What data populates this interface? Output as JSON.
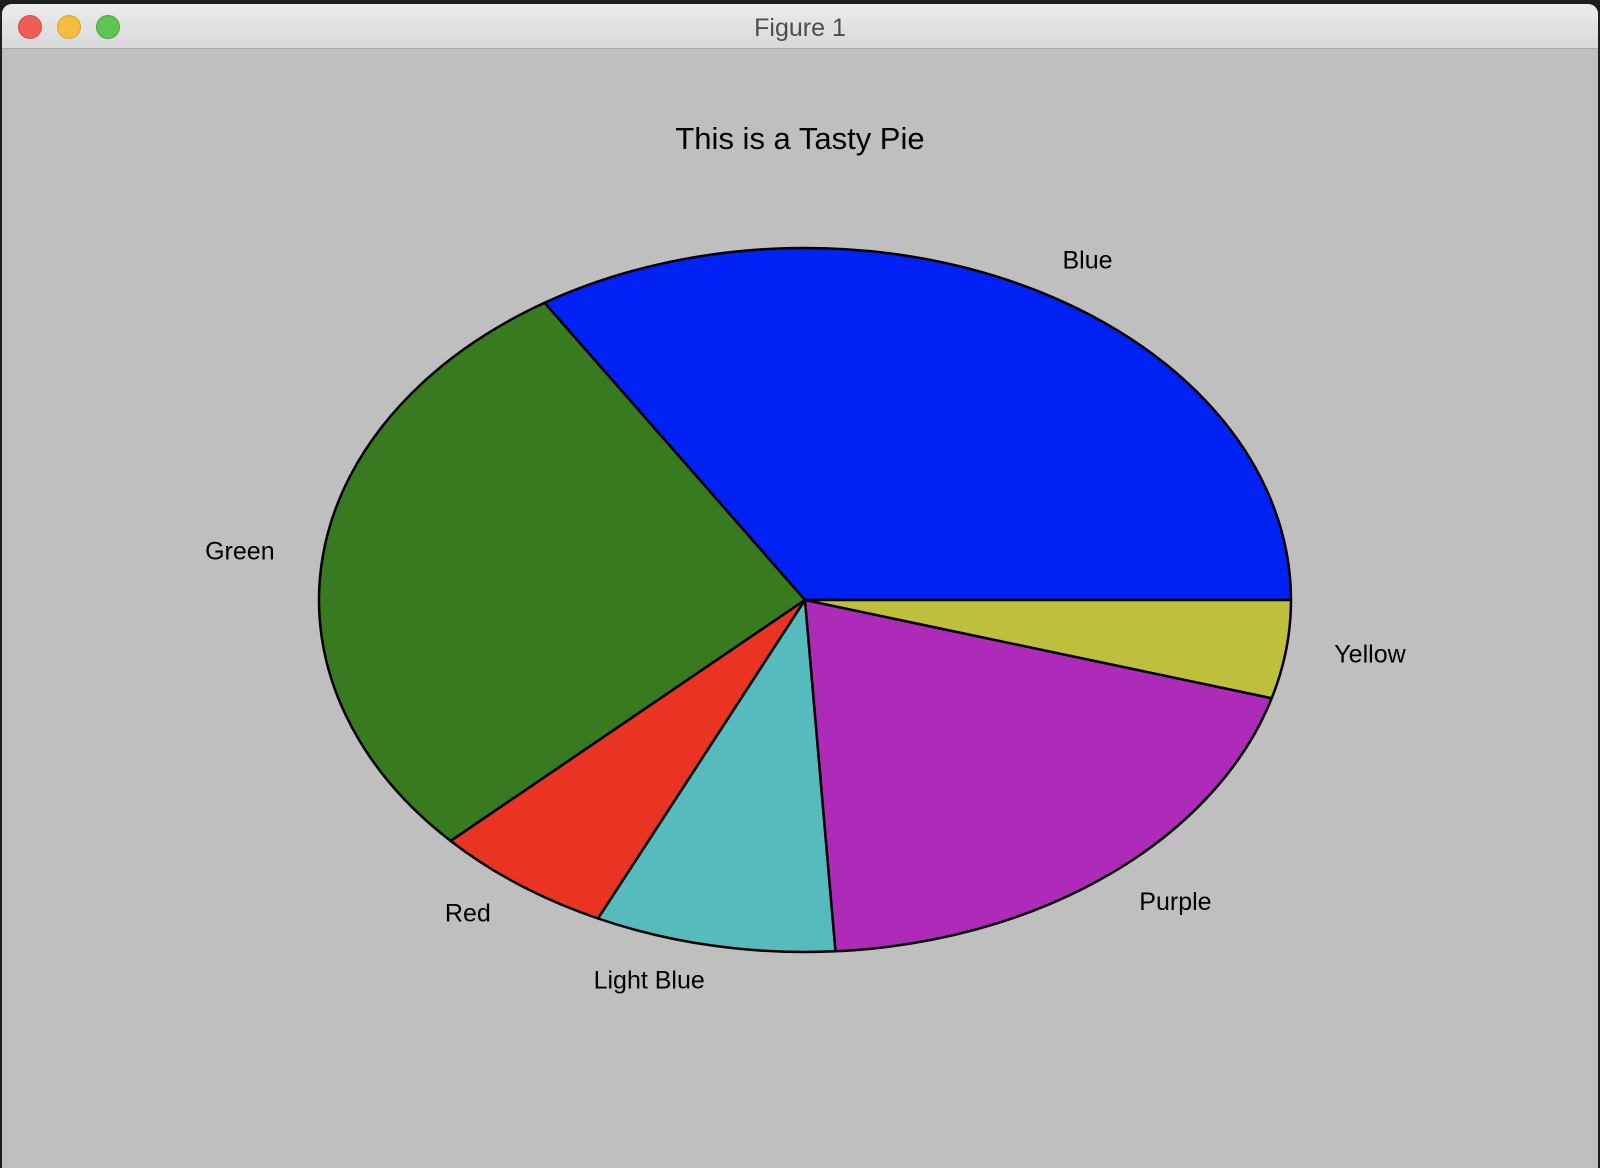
{
  "window": {
    "title": "Figure 1"
  },
  "chart_data": {
    "type": "pie",
    "title": "This is a Tasty Pie",
    "start_angle_deg": 0,
    "direction": "counterclockwise",
    "categories": [
      "Blue",
      "Green",
      "Red",
      "Light Blue",
      "Purple",
      "Yellow"
    ],
    "values": [
      34,
      28,
      6,
      8,
      19.5,
      4.5
    ],
    "colors": [
      "#0022f5",
      "#387a20",
      "#e93323",
      "#55bbbd",
      "#ad2bb8",
      "#bfbf3e"
    ],
    "edge_color": "#000000"
  }
}
